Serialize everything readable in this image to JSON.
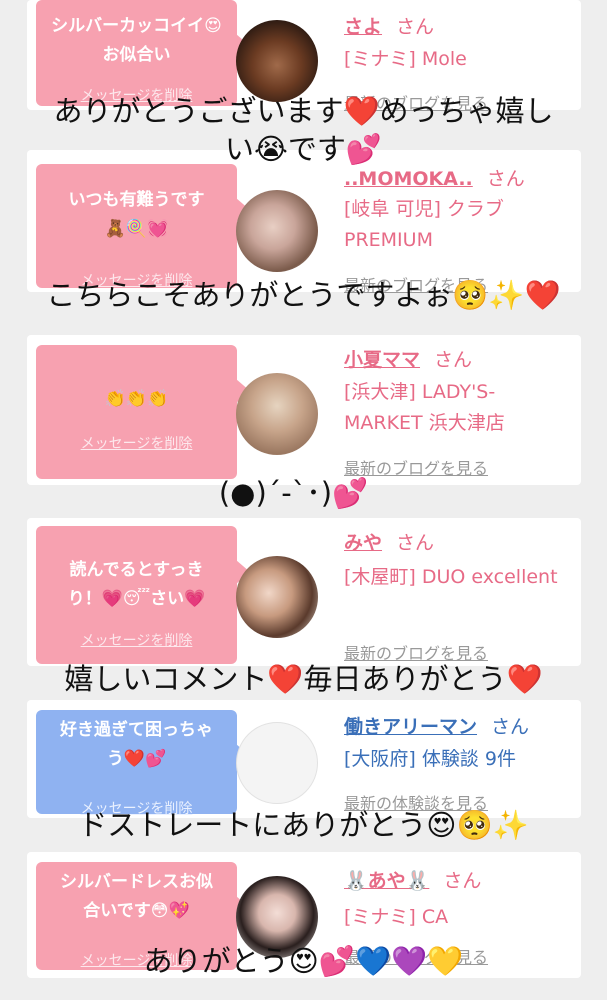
{
  "cards": [
    {
      "message": "シルバーカッコイイ😍お似合い",
      "delete": "メッセージを削除",
      "name": "さよ",
      "suffix": "さん",
      "shop": "[ミナミ] Mole",
      "blog": "最新のブログを見る"
    },
    {
      "message": "いつも有難うです🧸🍭💓",
      "delete": "メッセージを削除",
      "name": "..MOMOKA..",
      "suffix": "さん",
      "shop": "[岐阜 可児] クラブPREMIUM",
      "blog": "最新のブログを見る"
    },
    {
      "message": "👏👏👏",
      "delete": "メッセージを削除",
      "name": "小夏ママ",
      "suffix": "さん",
      "shop": "[浜大津] LADY'S-MARKET 浜大津店",
      "blog": "最新のブログを見る"
    },
    {
      "message": "読んでるとすっきり！💗😴さい💗",
      "delete": "メッセージを削除",
      "name": "みや",
      "suffix": "さん",
      "shop": "[木屋町] DUO excellent",
      "blog": "最新のブログを見る"
    },
    {
      "message": "好き過ぎて困っちゃう❤️💕",
      "delete": "メッセージを削除",
      "name": "働きアリーマン",
      "suffix": "さん",
      "shop": "[大阪府] 体験談 9件",
      "blog": "最新の体験談を見る"
    },
    {
      "message": "シルバードレスお似合いです😳💖",
      "delete": "メッセージを削除",
      "name": "🐰あや🐰",
      "suffix": "さん",
      "shop": "[ミナミ] CA",
      "blog": "最新のブログを見る"
    }
  ],
  "overlays": [
    {
      "line1": "ありがとうございます❤️めっちゃ嬉し",
      "line2": "い😭です💕"
    },
    {
      "line1": "こちらこそありがとうですよぉ🥺✨❤️"
    },
    {
      "line1": "(●)´-`･)💕"
    },
    {
      "line1": "嬉しいコメント❤️毎日ありがとう❤️"
    },
    {
      "line1": "ドストレートにありがとう😍🥺✨"
    },
    {
      "line1": "ありがとう😍💕💙💜💛"
    }
  ]
}
